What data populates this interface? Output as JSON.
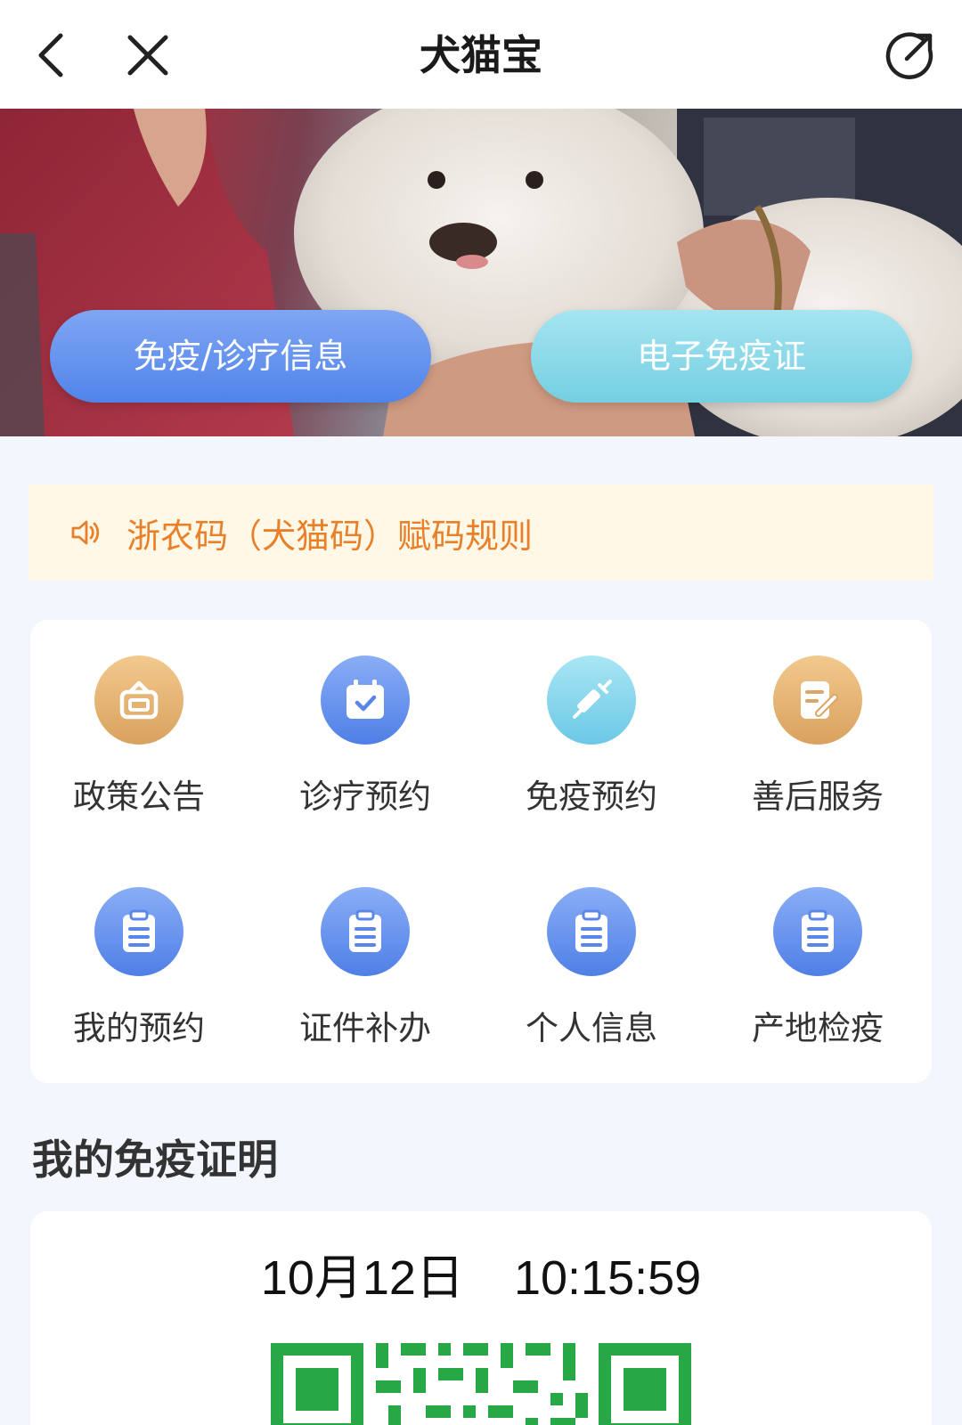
{
  "nav": {
    "title": "犬猫宝",
    "back_icon": "chevron-left-icon",
    "close_icon": "close-icon",
    "share_icon": "share-icon"
  },
  "banner": {
    "buttons": [
      {
        "label": "免疫/诊疗信息",
        "color": "#5f8fee"
      },
      {
        "label": "电子免疫证",
        "color": "#86d8ea"
      }
    ]
  },
  "notice": {
    "icon": "speaker-icon",
    "text": "浙农码（犬猫码）赋码规则",
    "color": "#e8802a",
    "background": "#fff8e6"
  },
  "services": [
    {
      "label": "政策公告",
      "icon": "announcement-icon",
      "style": "gold"
    },
    {
      "label": "诊疗预约",
      "icon": "calendar-check-icon",
      "style": "blue"
    },
    {
      "label": "免疫预约",
      "icon": "syringe-icon",
      "style": "cyan"
    },
    {
      "label": "善后服务",
      "icon": "note-edit-icon",
      "style": "gold"
    },
    {
      "label": "我的预约",
      "icon": "clipboard-icon",
      "style": "blue"
    },
    {
      "label": "证件补办",
      "icon": "clipboard-icon",
      "style": "blue"
    },
    {
      "label": "个人信息",
      "icon": "clipboard-icon",
      "style": "blue"
    },
    {
      "label": "产地检疫",
      "icon": "clipboard-icon",
      "style": "blue"
    }
  ],
  "certificate": {
    "section_title": "我的免疫证明",
    "date": "10月12日",
    "time": "10:15:59",
    "qr_color": "#27a844"
  }
}
